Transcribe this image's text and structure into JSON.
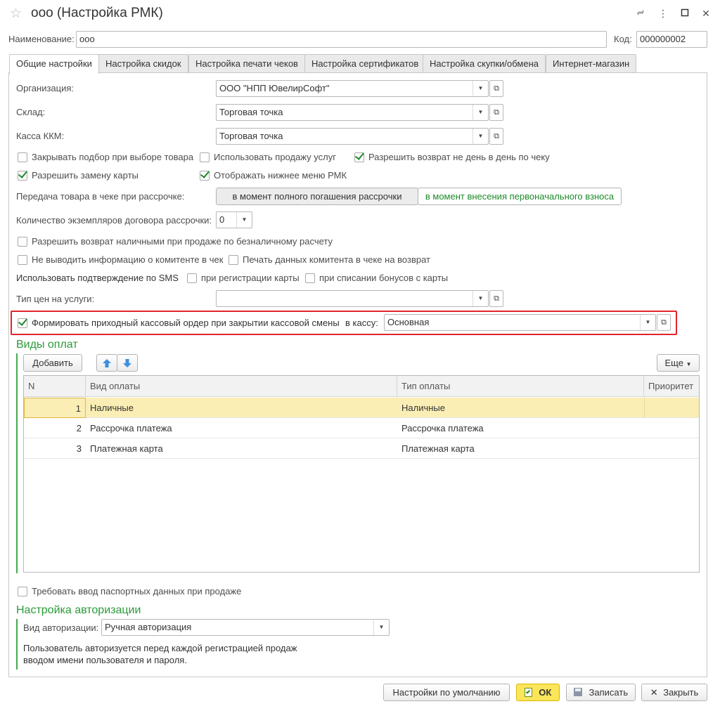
{
  "window": {
    "title": "ооо (Настройка РМК)",
    "icons": [
      "star-icon",
      "link-icon",
      "more-icon",
      "maximize-icon",
      "close-icon"
    ]
  },
  "header": {
    "name_label": "Наименование:",
    "name_value": "ооо",
    "code_label": "Код:",
    "code_value": "000000002"
  },
  "tabs": [
    {
      "label": "Общие настройки",
      "active": true
    },
    {
      "label": "Настройка скидок"
    },
    {
      "label": "Настройка печати чеков"
    },
    {
      "label": "Настройка сертификатов"
    },
    {
      "label": "Настройка скупки/обмена"
    },
    {
      "label": "Интернет-магазин"
    }
  ],
  "form": {
    "organization_label": "Организация:",
    "organization_value": "ООО \"НПП ЮвелирСофт\"",
    "warehouse_label": "Склад:",
    "warehouse_value": "Торговая точка",
    "kkm_label": "Касса ККМ:",
    "kkm_value": "Торговая точка",
    "checks_row1": [
      {
        "label": "Закрывать подбор при выборе товара",
        "checked": false
      },
      {
        "label": "Использовать продажу услуг",
        "checked": false
      },
      {
        "label": "Разрешить возврат не день в день по чеку",
        "checked": true
      }
    ],
    "checks_row2": [
      {
        "label": "Разрешить замену карты",
        "checked": true
      },
      {
        "label": "Отображать нижнее меню РМК",
        "checked": true
      }
    ],
    "installment_label": "Передача товара в чеке при рассрочке:",
    "installment_options": [
      "в момент полного погашения рассрочки",
      "в момент внесения первоначального взноса"
    ],
    "contract_copies_label": "Количество экземпляров договора рассрочки:",
    "contract_copies_value": "0",
    "cash_return_label": "Разрешить возврат наличными при продаже по безналичному расчету",
    "no_committent_label": "Не выводить информацию о комитенте в чек",
    "print_committent_label": "Печать данных комитента в чеке на возврат",
    "sms_label": "Использовать подтверждение по SMS",
    "sms_on_register_label": "при регистрации карты",
    "sms_on_bonus_label": "при списании бонусов с карты",
    "service_price_label": "Тип цен на услуги:",
    "service_price_value": "",
    "cash_order_label": "Формировать приходный кассовый ордер при закрытии кассовой смены",
    "cash_order_checked": true,
    "to_cashbox_label": "в кассу:",
    "to_cashbox_value": "Основная"
  },
  "payments": {
    "section_title": "Виды оплат",
    "add_label": "Добавить",
    "more_label": "Еще",
    "columns": [
      "N",
      "Вид оплаты",
      "Тип оплаты",
      "Приоритет"
    ],
    "rows": [
      {
        "n": "1",
        "kind": "Наличные",
        "type": "Наличные",
        "priority": ""
      },
      {
        "n": "2",
        "kind": "Рассрочка платежа",
        "type": "Рассрочка платежа",
        "priority": ""
      },
      {
        "n": "3",
        "kind": "Платежная карта",
        "type": "Платежная карта",
        "priority": ""
      }
    ]
  },
  "passport_label": "Требовать ввод паспортных данных при продаже",
  "auth": {
    "section_title": "Настройка авторизации",
    "type_label": "Вид авторизации:",
    "type_value": "Ручная авторизация",
    "note_line1": "Пользователь авторизуется перед каждой регистрацией продаж",
    "note_line2": "вводом имени пользователя и пароля."
  },
  "footer": {
    "defaults_label": "Настройки по умолчанию",
    "ok_label": "ОК",
    "save_label": "Записать",
    "close_label": "Закрыть"
  },
  "colors": {
    "accent_green": "#2c9a3a",
    "highlight_red": "#e3242b",
    "selected_row": "#fbeeb5",
    "ok_yellow": "#fbe55a"
  }
}
